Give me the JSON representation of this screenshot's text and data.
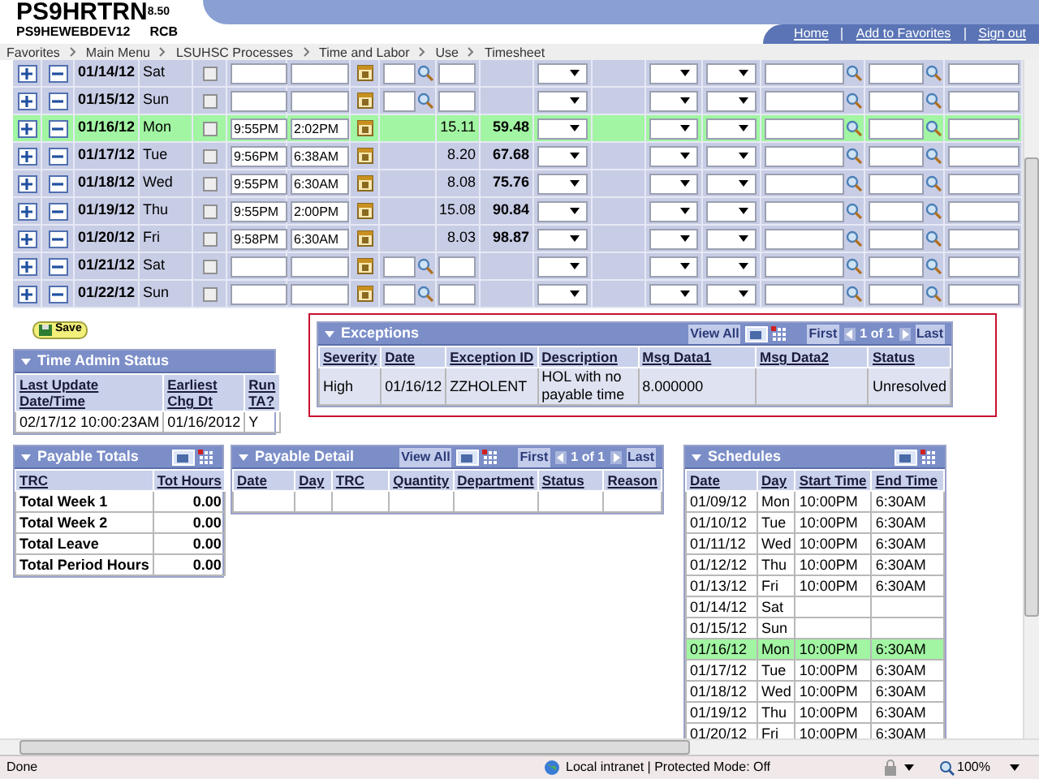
{
  "header": {
    "title": "PS9HRTRN",
    "version": "8.50",
    "database": "PS9HEWEBDEV12",
    "user": "RCB",
    "links": [
      "Home",
      "Add to Favorites",
      "Sign out"
    ]
  },
  "breadcrumbs": [
    "Favorites",
    "Main Menu",
    "LSUHSC Processes",
    "Time and Labor",
    "Use",
    "Timesheet"
  ],
  "timesheet": {
    "rows": [
      {
        "kind": "empty",
        "date": "01/14/12",
        "day": "Sat",
        "checked": false,
        "selected": false
      },
      {
        "kind": "empty",
        "date": "01/15/12",
        "day": "Sun",
        "checked": false,
        "selected": false
      },
      {
        "kind": "worked",
        "date": "01/16/12",
        "day": "Mon",
        "checked": false,
        "selected": true,
        "in": "9:55PM",
        "out": "2:02PM",
        "hours": "15.11",
        "total": "59.48"
      },
      {
        "kind": "worked",
        "date": "01/17/12",
        "day": "Tue",
        "checked": false,
        "selected": false,
        "in": "9:56PM",
        "out": "6:38AM",
        "hours": "8.20",
        "total": "67.68"
      },
      {
        "kind": "worked",
        "date": "01/18/12",
        "day": "Wed",
        "checked": false,
        "selected": false,
        "in": "9:55PM",
        "out": "6:30AM",
        "hours": "8.08",
        "total": "75.76"
      },
      {
        "kind": "worked",
        "date": "01/19/12",
        "day": "Thu",
        "checked": false,
        "selected": false,
        "in": "9:55PM",
        "out": "2:00PM",
        "hours": "15.08",
        "total": "90.84"
      },
      {
        "kind": "worked",
        "date": "01/20/12",
        "day": "Fri",
        "checked": false,
        "selected": false,
        "in": "9:58PM",
        "out": "6:30AM",
        "hours": "8.03",
        "total": "98.87"
      },
      {
        "kind": "empty",
        "date": "01/21/12",
        "day": "Sat",
        "checked": false,
        "selected": false
      },
      {
        "kind": "empty",
        "date": "01/22/12",
        "day": "Sun",
        "checked": false,
        "selected": false
      }
    ]
  },
  "save_button": "Save",
  "time_admin_status": {
    "title": "Time Admin Status",
    "columns": [
      "Last Update Date/Time",
      "Earliest Chg Dt",
      "Run TA?"
    ],
    "row": [
      "02/17/12 10:00:23AM",
      "01/16/2012",
      "Y"
    ]
  },
  "exceptions": {
    "title": "Exceptions",
    "nav": {
      "view_all": "View All",
      "first": "First",
      "range": "1 of 1",
      "last": "Last"
    },
    "columns": [
      "Severity",
      "Date",
      "Exception ID",
      "Description",
      "Msg Data1",
      "Msg Data2",
      "Status"
    ],
    "rows": [
      {
        "severity": "High",
        "date": "01/16/12",
        "exception_id": "ZZHOLENT",
        "description": "HOL with no payable time",
        "msg_data1": "8.000000",
        "status": "Unresolved"
      }
    ]
  },
  "payable_totals": {
    "title": "Payable Totals",
    "columns": [
      "TRC",
      "Tot Hours"
    ],
    "rows": [
      {
        "label": "Total Week 1",
        "value": "0.00"
      },
      {
        "label": "Total Week 2",
        "value": "0.00"
      },
      {
        "label": "Total Leave",
        "value": "0.00"
      },
      {
        "label": "Total Period Hours",
        "value": "0.00"
      }
    ]
  },
  "payable_detail": {
    "title": "Payable Detail",
    "nav": {
      "view_all": "View All",
      "first": "First",
      "range": "1 of 1",
      "last": "Last"
    },
    "columns": [
      "Date",
      "Day",
      "TRC",
      "Quantity",
      "Department",
      "Status",
      "Reason"
    ]
  },
  "schedules": {
    "title": "Schedules",
    "columns": [
      "Date",
      "Day",
      "Start Time",
      "End Time"
    ],
    "rows": [
      {
        "date": "01/09/12",
        "day": "Mon",
        "start": "10:00PM",
        "end": "6:30AM",
        "selected": false
      },
      {
        "date": "01/10/12",
        "day": "Tue",
        "start": "10:00PM",
        "end": "6:30AM",
        "selected": false
      },
      {
        "date": "01/11/12",
        "day": "Wed",
        "start": "10:00PM",
        "end": "6:30AM",
        "selected": false
      },
      {
        "date": "01/12/12",
        "day": "Thu",
        "start": "10:00PM",
        "end": "6:30AM",
        "selected": false
      },
      {
        "date": "01/13/12",
        "day": "Fri",
        "start": "10:00PM",
        "end": "6:30AM",
        "selected": false
      },
      {
        "date": "01/14/12",
        "day": "Sat",
        "selected": false
      },
      {
        "date": "01/15/12",
        "day": "Sun",
        "selected": false
      },
      {
        "date": "01/16/12",
        "day": "Mon",
        "start": "10:00PM",
        "end": "6:30AM",
        "selected": true
      },
      {
        "date": "01/17/12",
        "day": "Tue",
        "start": "10:00PM",
        "end": "6:30AM",
        "selected": false
      },
      {
        "date": "01/18/12",
        "day": "Wed",
        "start": "10:00PM",
        "end": "6:30AM",
        "selected": false
      },
      {
        "date": "01/19/12",
        "day": "Thu",
        "start": "10:00PM",
        "end": "6:30AM",
        "selected": false
      },
      {
        "date": "01/20/12",
        "day": "Fri",
        "start": "10:00PM",
        "end": "6:30AM",
        "selected": false
      }
    ]
  },
  "status_bar": {
    "text": "Done",
    "zone": "Local intranet | Protected Mode: Off",
    "zoom": "100%"
  }
}
